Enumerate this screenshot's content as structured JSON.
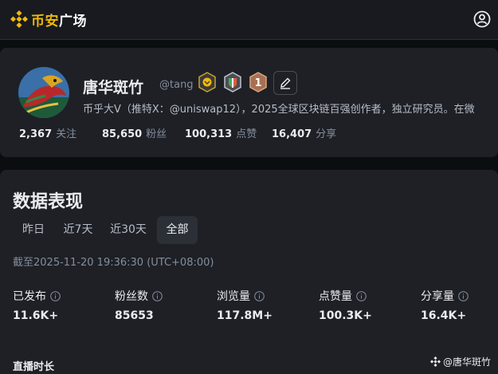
{
  "header": {
    "logo_text": "币安",
    "logo_text_white": "广场",
    "brand_color": "#f0b90b"
  },
  "profile": {
    "name": "唐华斑竹",
    "handle": "@tang",
    "badges": [
      "gold-medal-icon",
      "shield-badge-icon",
      "rank-one-icon"
    ],
    "bio": "币乎大V（推特X：@uniswap12），2025全球区块链百强创作者，独立研究员。在微",
    "stats": [
      {
        "value": "2,367",
        "label": "关注"
      },
      {
        "value": "85,650",
        "label": "粉丝"
      },
      {
        "value": "100,313",
        "label": "点赞"
      },
      {
        "value": "16,407",
        "label": "分享"
      }
    ]
  },
  "data": {
    "title": "数据表现",
    "tabs": [
      "昨日",
      "近7天",
      "近30天",
      "全部"
    ],
    "active_tab": "全部",
    "as_of": "截至2025-11-20 19:36:30 (UTC+08:00)",
    "metrics": [
      {
        "label": "已发布",
        "value": "11.6K+"
      },
      {
        "label": "粉丝数",
        "value": "85653"
      },
      {
        "label": "浏览量",
        "value": "117.8M+"
      },
      {
        "label": "点赞量",
        "value": "100.3K+"
      },
      {
        "label": "分享量",
        "value": "16.4K+"
      }
    ],
    "live_title": "直播时长",
    "watermark": "@唐华斑竹"
  }
}
